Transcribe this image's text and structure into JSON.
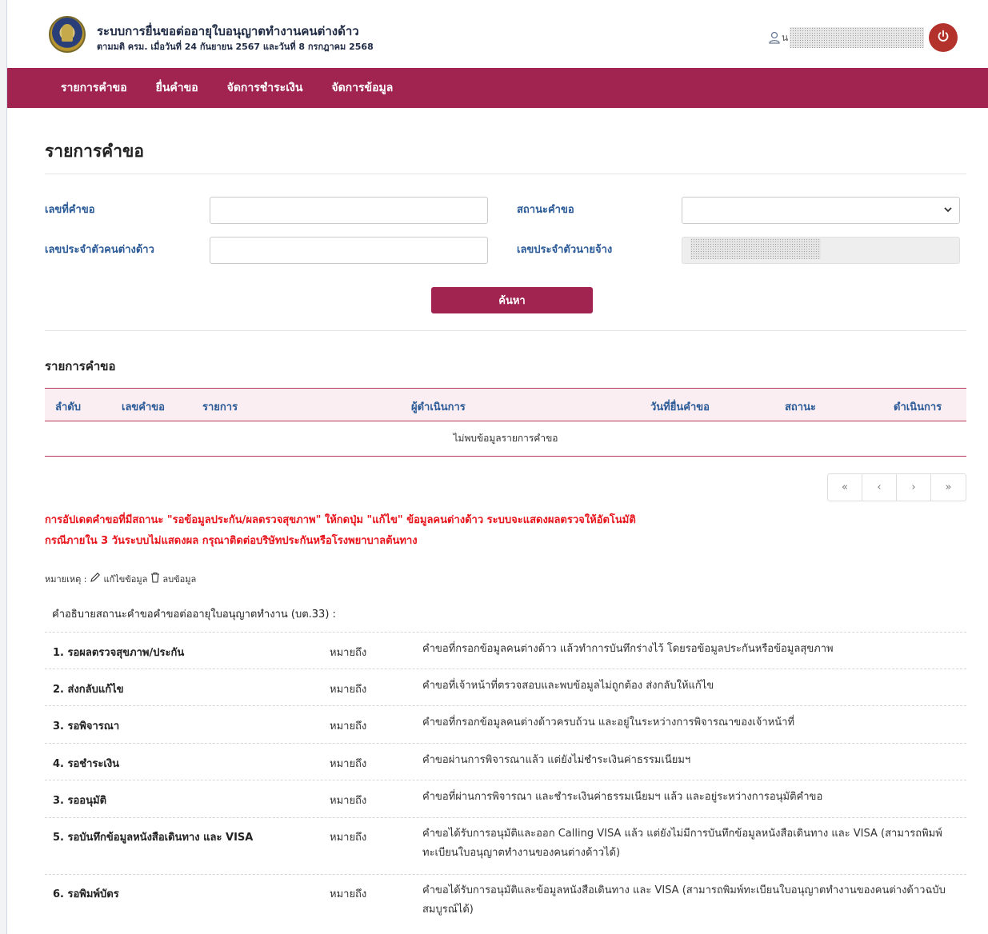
{
  "header": {
    "title": "ระบบการยื่นขอต่ออายุใบอนุญาตทำงานคนต่างด้าว",
    "subtitle": "ตามมติ ครม. เมื่อวันที่ 24 กันยายน 2567 และวันที่ 8 กรกฎาคม 2568",
    "user_initial": "น",
    "logo_icon": "agency-seal-icon",
    "user_icon": "user-icon",
    "logout_icon": "power-icon"
  },
  "nav": {
    "items": [
      "รายการคำขอ",
      "ยื่นคำขอ",
      "จัดการชำระเงิน",
      "จัดการข้อมูล"
    ]
  },
  "page": {
    "title": "รายการคำขอ"
  },
  "search": {
    "request_no_label": "เลขที่คำขอ",
    "status_label": "สถานะคำขอ",
    "alien_id_label": "เลขประจำตัวคนต่างด้าว",
    "employer_id_label": "เลขประจำตัวนายจ้าง",
    "button_label": "ค้นหา"
  },
  "table": {
    "section_title": "รายการคำขอ",
    "columns": [
      "ลำดับ",
      "เลขคำขอ",
      "รายการ",
      "ผู้ดำเนินการ",
      "วันที่ยื่นคำขอ",
      "สถานะ",
      "ดำเนินการ"
    ],
    "empty_message": "ไม่พบข้อมูลรายการคำขอ"
  },
  "pagination": [
    "«",
    "‹",
    "›",
    "»"
  ],
  "warning": {
    "line1": "การอัปเดตคำขอที่มีสถานะ \"รอข้อมูลประกัน/ผลตรวจสุขภาพ\" ให้กดปุ่ม \"แก้ไข\" ข้อมูลคนต่างด้าว ระบบจะแสดงผลตรวจให้อัตโนมัติ",
    "line2": "กรณีภายใน 3 วันระบบไม่แสดงผล กรุณาติดต่อบริษัทประกันหรือโรงพยาบาลต้นทาง"
  },
  "remark": {
    "prefix": "หมายเหตุ :",
    "edit_label": "แก้ไขข้อมูล",
    "delete_label": "ลบข้อมูล"
  },
  "status_desc": {
    "title": "คำอธิบายสถานะคำขอคำขอต่ออายุใบอนุญาตทำงาน (บต.33) :",
    "rows": [
      {
        "name": "1. รอผลตรวจสุขภาพ/ประกัน",
        "means": "หมายถึง",
        "desc": "คำขอที่กรอกข้อมูลคนต่างด้าว แล้วทำการบันทึกร่างไว้ โดยรอข้อมูลประกันหรือข้อมูลสุขภาพ"
      },
      {
        "name": "2. ส่งกลับแก้ไข",
        "means": "หมายถึง",
        "desc": "คำขอที่เจ้าหน้าที่ตรวจสอบและพบข้อมูลไม่ถูกต้อง ส่งกลับให้แก้ไข"
      },
      {
        "name": "3. รอพิจารณา",
        "means": "หมายถึง",
        "desc": "คำขอที่กรอกข้อมูลคนต่างด้าวครบถ้วน และอยู่ในระหว่างการพิจารณาของเจ้าหน้าที่"
      },
      {
        "name": "4. รอชำระเงิน",
        "means": "หมายถึง",
        "desc": "คำขอผ่านการพิจารณาแล้ว แต่ยังไม่ชำระเงินค่าธรรมเนียมฯ"
      },
      {
        "name": "3. รออนุมัติ",
        "means": "หมายถึง",
        "desc": "คำขอที่ผ่านการพิจารณา และชำระเงินค่าธรรมเนียมฯ แล้ว และอยู่ระหว่างการอนุมัติคำขอ"
      },
      {
        "name": "5. รอบันทึกข้อมูลหนังสือเดินทาง และ VISA",
        "means": "หมายถึง",
        "desc": "คำขอได้รับการอนุมัติและออก Calling VISA แล้ว แต่ยังไม่มีการบันทึกข้อมูลหนังสือเดินทาง และ VISA (สามารถพิมพ์ทะเบียนใบอนุญาตทำงานของคนต่างด้าวได้)"
      },
      {
        "name": "6. รอพิมพ์บัตร",
        "means": "หมายถึง",
        "desc": "คำขอได้รับการอนุมัติและข้อมูลหนังสือเดินทาง และ VISA (สามารถพิมพ์ทะเบียนใบอนุญาตทำงานของคนต่างด้าวฉบับสมบูรณ์ได้)"
      }
    ]
  },
  "colors": {
    "brand": "#a0244f",
    "label_blue": "#2a5a97",
    "warning_red": "#e8141c"
  }
}
